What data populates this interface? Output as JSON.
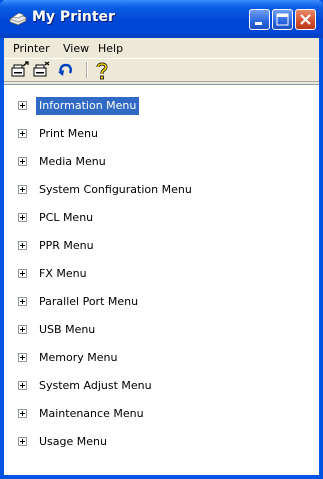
{
  "window": {
    "title": "My Printer"
  },
  "menu": [
    "Printer",
    "View",
    "Help"
  ],
  "toolbar": [
    "properties-icon",
    "printer-settings-icon",
    "undo-icon",
    "help-icon"
  ],
  "tree": {
    "selected_index": 0,
    "items": [
      "Information Menu",
      "Print Menu",
      "Media Menu",
      "System Configuration Menu",
      "PCL Menu",
      "PPR Menu",
      "FX Menu",
      "Parallel Port Menu",
      "USB Menu",
      "Memory Menu",
      "System Adjust Menu",
      "Maintenance Menu",
      "Usage Menu"
    ]
  },
  "colors": {
    "title_bar": "#0054e3",
    "selection": "#316ac5"
  }
}
